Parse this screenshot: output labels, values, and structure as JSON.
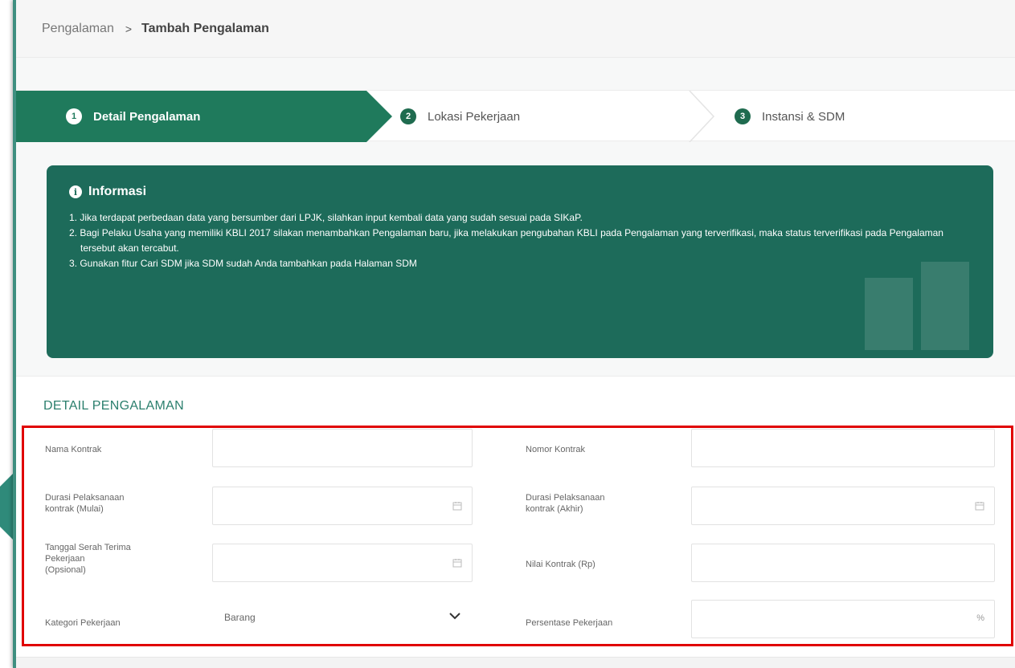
{
  "breadcrumb": {
    "parent": "Pengalaman",
    "separator": ">",
    "current": "Tambah Pengalaman"
  },
  "stepper": {
    "steps": [
      {
        "number": "1",
        "label": "Detail Pengalaman",
        "active": true
      },
      {
        "number": "2",
        "label": "Lokasi Pekerjaan",
        "active": false
      },
      {
        "number": "3",
        "label": "Instansi & SDM",
        "active": false
      }
    ]
  },
  "info": {
    "icon": "info-circle-icon",
    "title": "Informasi",
    "items": [
      "1. Jika terdapat perbedaan data yang bersumber dari LPJK, silahkan input kembali data yang sudah sesuai pada SIKaP.",
      "2. Bagi Pelaku Usaha yang memiliki KBLI 2017 silakan menambahkan Pengalaman baru, jika melakukan pengubahan KBLI pada Pengalaman yang terverifikasi, maka status terverifikasi pada Pengalaman tersebut akan tercabut.",
      "3. Gunakan fitur Cari SDM jika SDM sudah Anda tambahkan pada Halaman SDM"
    ]
  },
  "detail": {
    "section_title": "DETAIL PENGALAMAN",
    "fields": {
      "nama_kontrak": {
        "label": "Nama Kontrak",
        "value": ""
      },
      "nomor_kontrak": {
        "label": "Nomor Kontrak",
        "value": ""
      },
      "durasi_mulai": {
        "label_line1": "Durasi Pelaksanaan",
        "label_line2": "kontrak (Mulai)",
        "value": "",
        "icon": "calendar-icon"
      },
      "durasi_akhir": {
        "label_line1": "Durasi Pelaksanaan",
        "label_line2": "kontrak (Akhir)",
        "value": "",
        "icon": "calendar-icon"
      },
      "tanggal_serah": {
        "label_line1": "Tanggal Serah Terima",
        "label_line2": "Pekerjaan",
        "label_line3": "(Opsional)",
        "value": "",
        "icon": "calendar-icon"
      },
      "nilai_kontrak": {
        "label": "Nilai Kontrak (Rp)",
        "value": ""
      },
      "kategori": {
        "label": "Kategori Pekerjaan",
        "value": "Barang",
        "icon": "chevron-down-icon"
      },
      "persentase": {
        "label": "Persentase Pekerjaan",
        "value": "",
        "suffix": "%"
      }
    }
  },
  "colors": {
    "primary_green": "#1f7a5c",
    "info_bg": "#1d6b5a",
    "section_title": "#2b7f6d",
    "highlight_red": "#e00000"
  }
}
